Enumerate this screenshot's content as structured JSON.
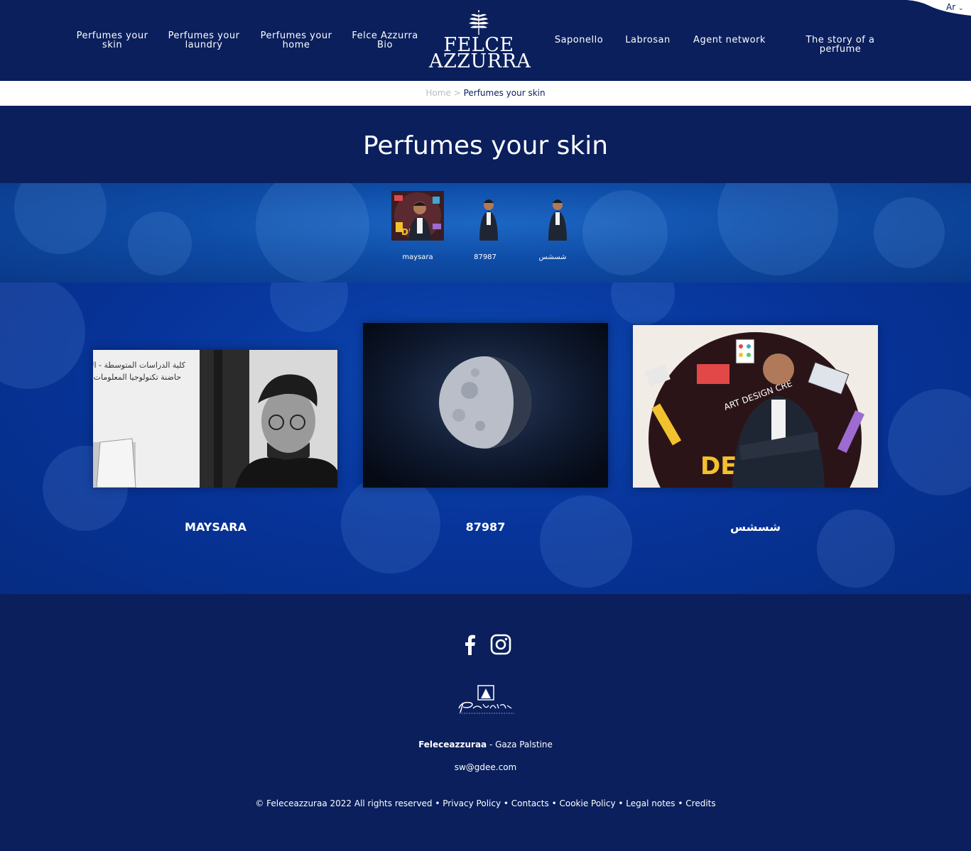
{
  "header": {
    "nav_left": [
      {
        "line1": "Perfumes your",
        "line2": "skin"
      },
      {
        "line1": "Perfumes your",
        "line2": "laundry"
      },
      {
        "line1": "Perfumes your",
        "line2": "home"
      },
      {
        "line1": "Felce Azzurra",
        "line2": "Bio"
      }
    ],
    "logo": {
      "line1": "FELCE",
      "line2": "AZZURRA"
    },
    "nav_right": [
      "Saponello",
      "Labrosan",
      "Agent network",
      "The story of a perfume"
    ],
    "language": "Ar"
  },
  "breadcrumb": {
    "home": "Home",
    "separator": ">",
    "current": "Perfumes your skin"
  },
  "page_title": "Perfumes your skin",
  "thumbnails": [
    {
      "label": "maysara",
      "icon": "person-photo-colorful-thumb"
    },
    {
      "label": "87987",
      "icon": "person-cutout-thumb"
    },
    {
      "label": "شسشس",
      "icon": "person-cutout-thumb"
    }
  ],
  "cards": [
    {
      "title": "MAYSARA",
      "image": "bw-portrait-photo"
    },
    {
      "title": "87987",
      "image": "moon-photo"
    },
    {
      "title": "شسشس",
      "image": "portrait-art-design-background-photo"
    }
  ],
  "footer": {
    "social": [
      "facebook-icon",
      "instagram-icon"
    ],
    "brand_name": "Feleceazzuraa",
    "brand_rest": " - Gaza Palstine",
    "email": "sw@gdee.com",
    "copyright": "© Feleceazzuraa 2022 All rights reserved",
    "links": [
      "Privacy Policy",
      "Contacts",
      "Cookie Policy",
      "Legal notes",
      "Credits"
    ]
  },
  "colors": {
    "navy": "#0a1f5c",
    "bokeh_blue": "#0c47b0",
    "white": "#ffffff"
  }
}
